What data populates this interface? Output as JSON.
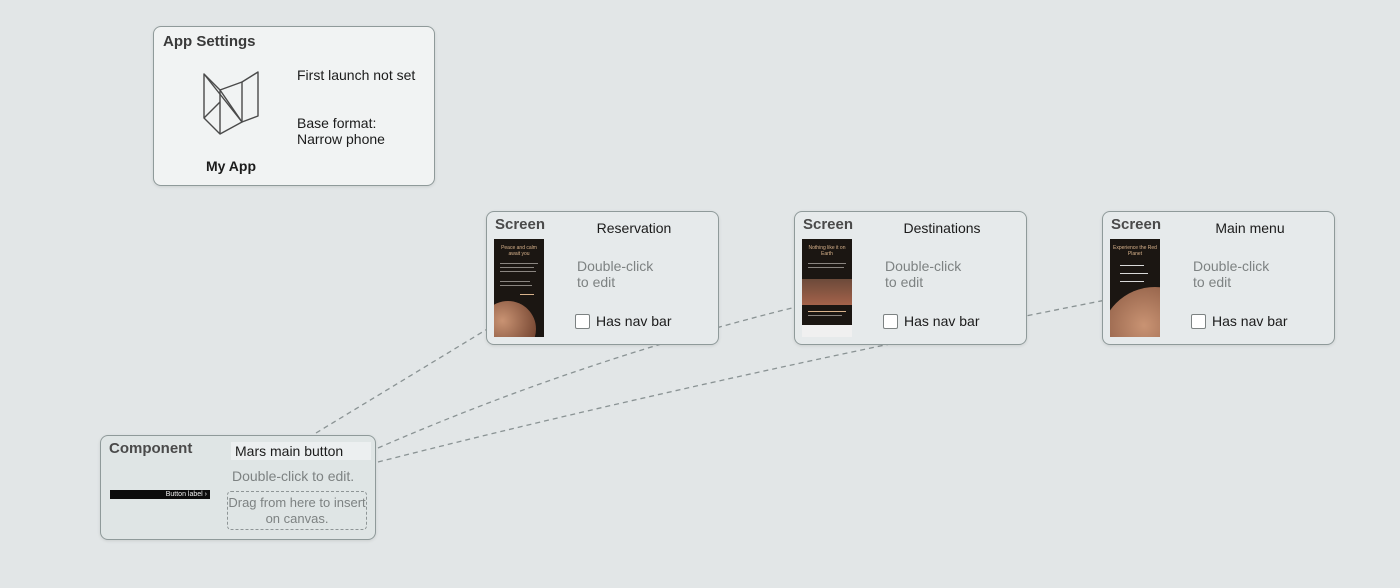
{
  "app_settings": {
    "kind": "App Settings",
    "app_name": "My App",
    "first_launch": "First launch not set",
    "base_format": "Base format: Narrow phone"
  },
  "screens": [
    {
      "kind": "Screen",
      "title": "Reservation",
      "edit_hint": "Double-click to edit",
      "nav_bar_label": "Has nav bar",
      "nav_bar_checked": false,
      "thumb_heading": "Peace and calm await you"
    },
    {
      "kind": "Screen",
      "title": "Destinations",
      "edit_hint": "Double-click to edit",
      "nav_bar_label": "Has nav bar",
      "nav_bar_checked": false,
      "thumb_heading": "Nothing like it on Earth"
    },
    {
      "kind": "Screen",
      "title": "Main menu",
      "edit_hint": "Double-click to edit",
      "nav_bar_label": "Has nav bar",
      "nav_bar_checked": false,
      "thumb_heading": "Experience the Red Planet"
    }
  ],
  "component": {
    "kind": "Component",
    "name": "Mars main button",
    "edit_hint": "Double-click to edit.",
    "preview_label": "Button label",
    "drag_hint": "Drag from here to insert on canvas."
  },
  "colors": {
    "canvas": "#e2e6e7",
    "card_border": "#8f9a9a",
    "hint_text": "#7d8282",
    "thumb_bg": "#1b1612",
    "mars": "#a4624a"
  }
}
